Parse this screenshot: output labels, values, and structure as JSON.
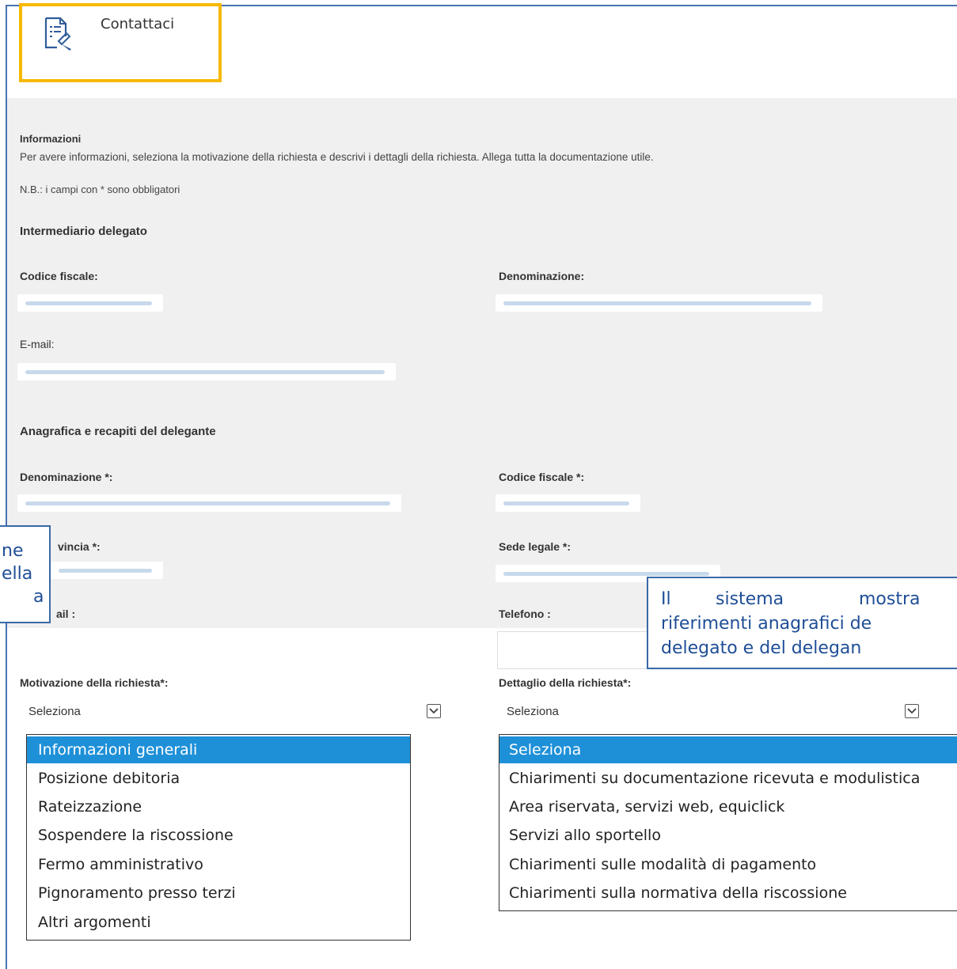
{
  "header": {
    "title": "Contattaci",
    "icon": "edit-document-icon"
  },
  "info": {
    "title": "Informazioni",
    "description": "Per avere informazioni, seleziona la motivazione della richiesta e descrivi i dettagli della richiesta. Allega tutta la documentazione utile.",
    "note": "N.B.: i campi con * sono obbligatori"
  },
  "intermediario": {
    "title": "Intermediario delegato",
    "codice_fiscale_label": "Codice fiscale:",
    "denominazione_label": "Denominazione:",
    "email_label": "E-mail:"
  },
  "delegante": {
    "title": "Anagrafica e recapiti del delegante",
    "denominazione_label": "Denominazione *:",
    "codice_fiscale_label": "Codice fiscale *:",
    "provincia_label": "vincia *:",
    "sede_label": "Sede legale *:",
    "email_label": "ail :",
    "telefono_label": "Telefono :"
  },
  "motivazione": {
    "label": "Motivazione della richiesta*:",
    "value": "Seleziona",
    "options": [
      "Informazioni generali",
      "Posizione debitoria",
      "Rateizzazione",
      "Sospendere la riscossione",
      "Fermo amministrativo",
      "Pignoramento presso terzi",
      "Altri argomenti"
    ],
    "selected": "Informazioni generali"
  },
  "dettaglio": {
    "label": "Dettaglio della richiesta*:",
    "value": "Seleziona",
    "options": [
      "Seleziona",
      "Chiarimenti su documentazione ricevuta e modulistica",
      "Area riservata, servizi web, equiclick",
      "Servizi allo sportello",
      "Chiarimenti sulle modalità di pagamento",
      "Chiarimenti sulla normativa della riscossione"
    ],
    "selected": "Seleziona"
  },
  "callout_left": {
    "lines": [
      "ne",
      "ella",
      "a"
    ]
  },
  "callout_right": {
    "lines": [
      "Il",
      "sistema",
      "mostra",
      "riferimenti anagrafici de",
      "delegato e del delegan"
    ]
  },
  "colors": {
    "accent_border": "#f5b800",
    "callout_border": "#3a68a8",
    "callout_text": "#1f4e96",
    "selection": "#1e90d8",
    "panel_bg": "#f0f0f0"
  }
}
